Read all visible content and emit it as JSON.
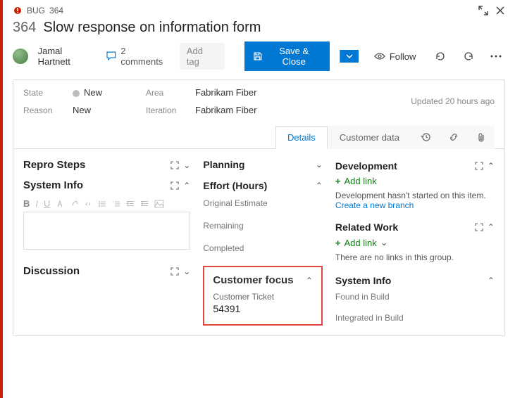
{
  "header": {
    "type_label": "BUG",
    "id": "364",
    "title": "Slow response on information form"
  },
  "assignee": {
    "name": "Jamal Hartnett"
  },
  "comments": {
    "count_label": "2 comments"
  },
  "tags": {
    "add_label": "Add tag"
  },
  "actions": {
    "save_label": "Save & Close",
    "follow_label": "Follow"
  },
  "fields": {
    "state_label": "State",
    "state_value": "New",
    "reason_label": "Reason",
    "reason_value": "New",
    "area_label": "Area",
    "area_value": "Fabrikam Fiber",
    "iteration_label": "Iteration",
    "iteration_value": "Fabrikam Fiber",
    "updated_label": "Updated 20 hours ago"
  },
  "tabs": {
    "details": "Details",
    "customer_data": "Customer data"
  },
  "left": {
    "repro_title": "Repro Steps",
    "sysinfo_title": "System Info",
    "discussion_title": "Discussion"
  },
  "middle": {
    "planning_title": "Planning",
    "effort_title": "Effort (Hours)",
    "original_estimate": "Original Estimate",
    "remaining": "Remaining",
    "completed": "Completed",
    "customer_focus_title": "Customer focus",
    "customer_ticket_label": "Customer Ticket",
    "customer_ticket_value": "54391"
  },
  "right": {
    "development_title": "Development",
    "add_link": "Add link",
    "dev_empty": "Development hasn't started on this item.",
    "create_branch": "Create a new branch",
    "related_title": "Related Work",
    "related_empty": "There are no links in this group.",
    "sysinfo_title": "System Info",
    "found_in_build": "Found in Build",
    "integrated_in_build": "Integrated in Build"
  }
}
